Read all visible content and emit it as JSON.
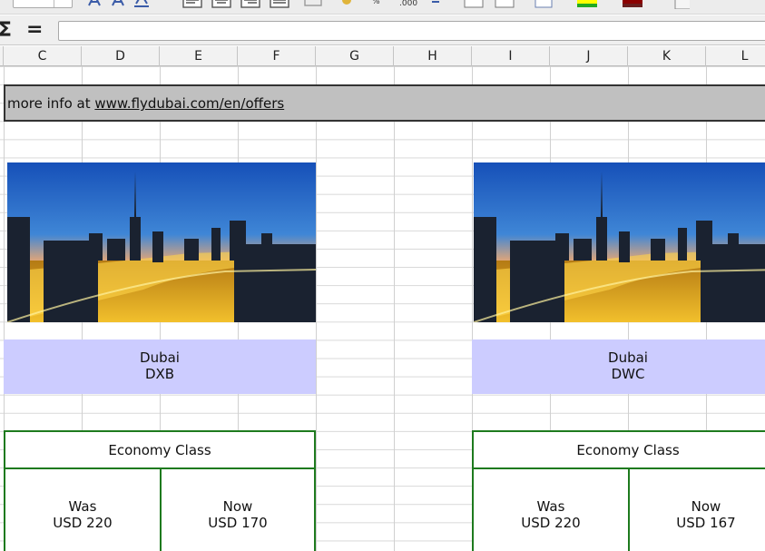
{
  "formula_bar": {
    "sum_symbol": "Σ",
    "equals_symbol": "=",
    "value": ""
  },
  "columns": [
    "C",
    "D",
    "E",
    "F",
    "G",
    "H",
    "I",
    "J",
    "K",
    "L"
  ],
  "info_bar": {
    "prefix": "more info at ",
    "link": "www.flydubai.com/en/offers",
    "suffix": "/en/offers"
  },
  "offers": [
    {
      "city": "Dubai",
      "code": "DXB",
      "class": "Economy Class",
      "was_label": "Was",
      "was_price": "USD 220",
      "now_label": "Now",
      "now_price": "USD 170"
    },
    {
      "city": "Dubai",
      "code": "DWC",
      "class": "Economy Class",
      "was_label": "Was",
      "was_price": "USD 220",
      "now_label": "Now",
      "now_price": "USD 167"
    }
  ],
  "colors": {
    "city_fill": "#ccccff",
    "info_fill": "#c0c0c0",
    "offer_border": "#1e7a1e"
  }
}
